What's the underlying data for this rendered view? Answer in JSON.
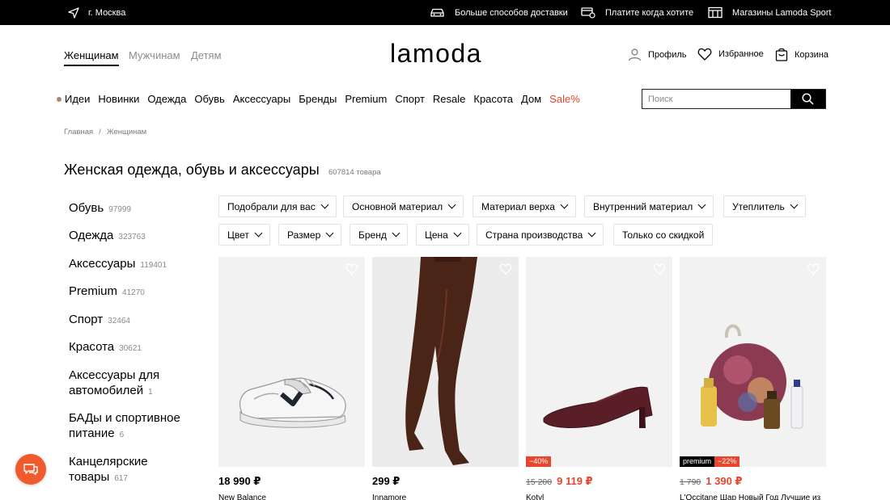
{
  "topbar": {
    "location": "г. Москва",
    "delivery": "Больше способов доставки",
    "pay_later": "Платите когда хотите",
    "stores": "Магазины Lamoda Sport"
  },
  "header": {
    "tabs": [
      "Женщинам",
      "Мужчинам",
      "Детям"
    ],
    "logo": "lamoda",
    "profile": "Профиль",
    "favorites": "Избранное",
    "cart": "Корзина"
  },
  "nav": {
    "items": [
      "Идеи",
      "Новинки",
      "Одежда",
      "Обувь",
      "Аксессуары",
      "Бренды",
      "Premium",
      "Спорт",
      "Resale",
      "Красота",
      "Дом"
    ],
    "sale": "Sale%"
  },
  "search": {
    "placeholder": "Поиск"
  },
  "breadcrumb": {
    "home": "Главная",
    "separator": "/",
    "current": "Женщинам"
  },
  "page": {
    "title": "Женская одежда, обувь и аксессуары",
    "count": "607814 товара"
  },
  "sidebar": [
    {
      "label": "Обувь",
      "count": "97999"
    },
    {
      "label": "Одежда",
      "count": "323763"
    },
    {
      "label": "Аксессуары",
      "count": "119401"
    },
    {
      "label": "Premium",
      "count": "41270"
    },
    {
      "label": "Спорт",
      "count": "32464"
    },
    {
      "label": "Красота",
      "count": "30621"
    },
    {
      "label_line1": "Аксессуары для",
      "label_line2": "автомобилей",
      "count": "1"
    },
    {
      "label_line1": "БАДы и спортивное",
      "label_line2": "питание",
      "count": "6"
    },
    {
      "label_line1": "Канцелярские",
      "label_line2": "товары",
      "count": "617"
    }
  ],
  "filters": {
    "row1": [
      "Подобрали для вас",
      "Основной материал",
      "Материал верха",
      "Внутренний материал",
      "Утеплитель"
    ],
    "row2": [
      "Цвет",
      "Размер",
      "Бренд",
      "Цена",
      "Страна производства"
    ],
    "discount_only": "Только со скидкой"
  },
  "products": [
    {
      "price": "18 990 ₽",
      "brand": "New Balance"
    },
    {
      "price": "299 ₽",
      "brand": "Innamore"
    },
    {
      "old_price": "15 200",
      "price": "9 119 ₽",
      "discount": "−40%",
      "brand": "Kotyl"
    },
    {
      "old_price": "1 790",
      "price": "1 390 ₽",
      "premium": "premium",
      "discount": "−22%",
      "brand": "L'Occitane Шар Новый Год Лучшие из"
    }
  ],
  "colors": {
    "accent": "#e8452e",
    "chat": "#f15a2c",
    "idea_dot": "#a58b6d"
  }
}
